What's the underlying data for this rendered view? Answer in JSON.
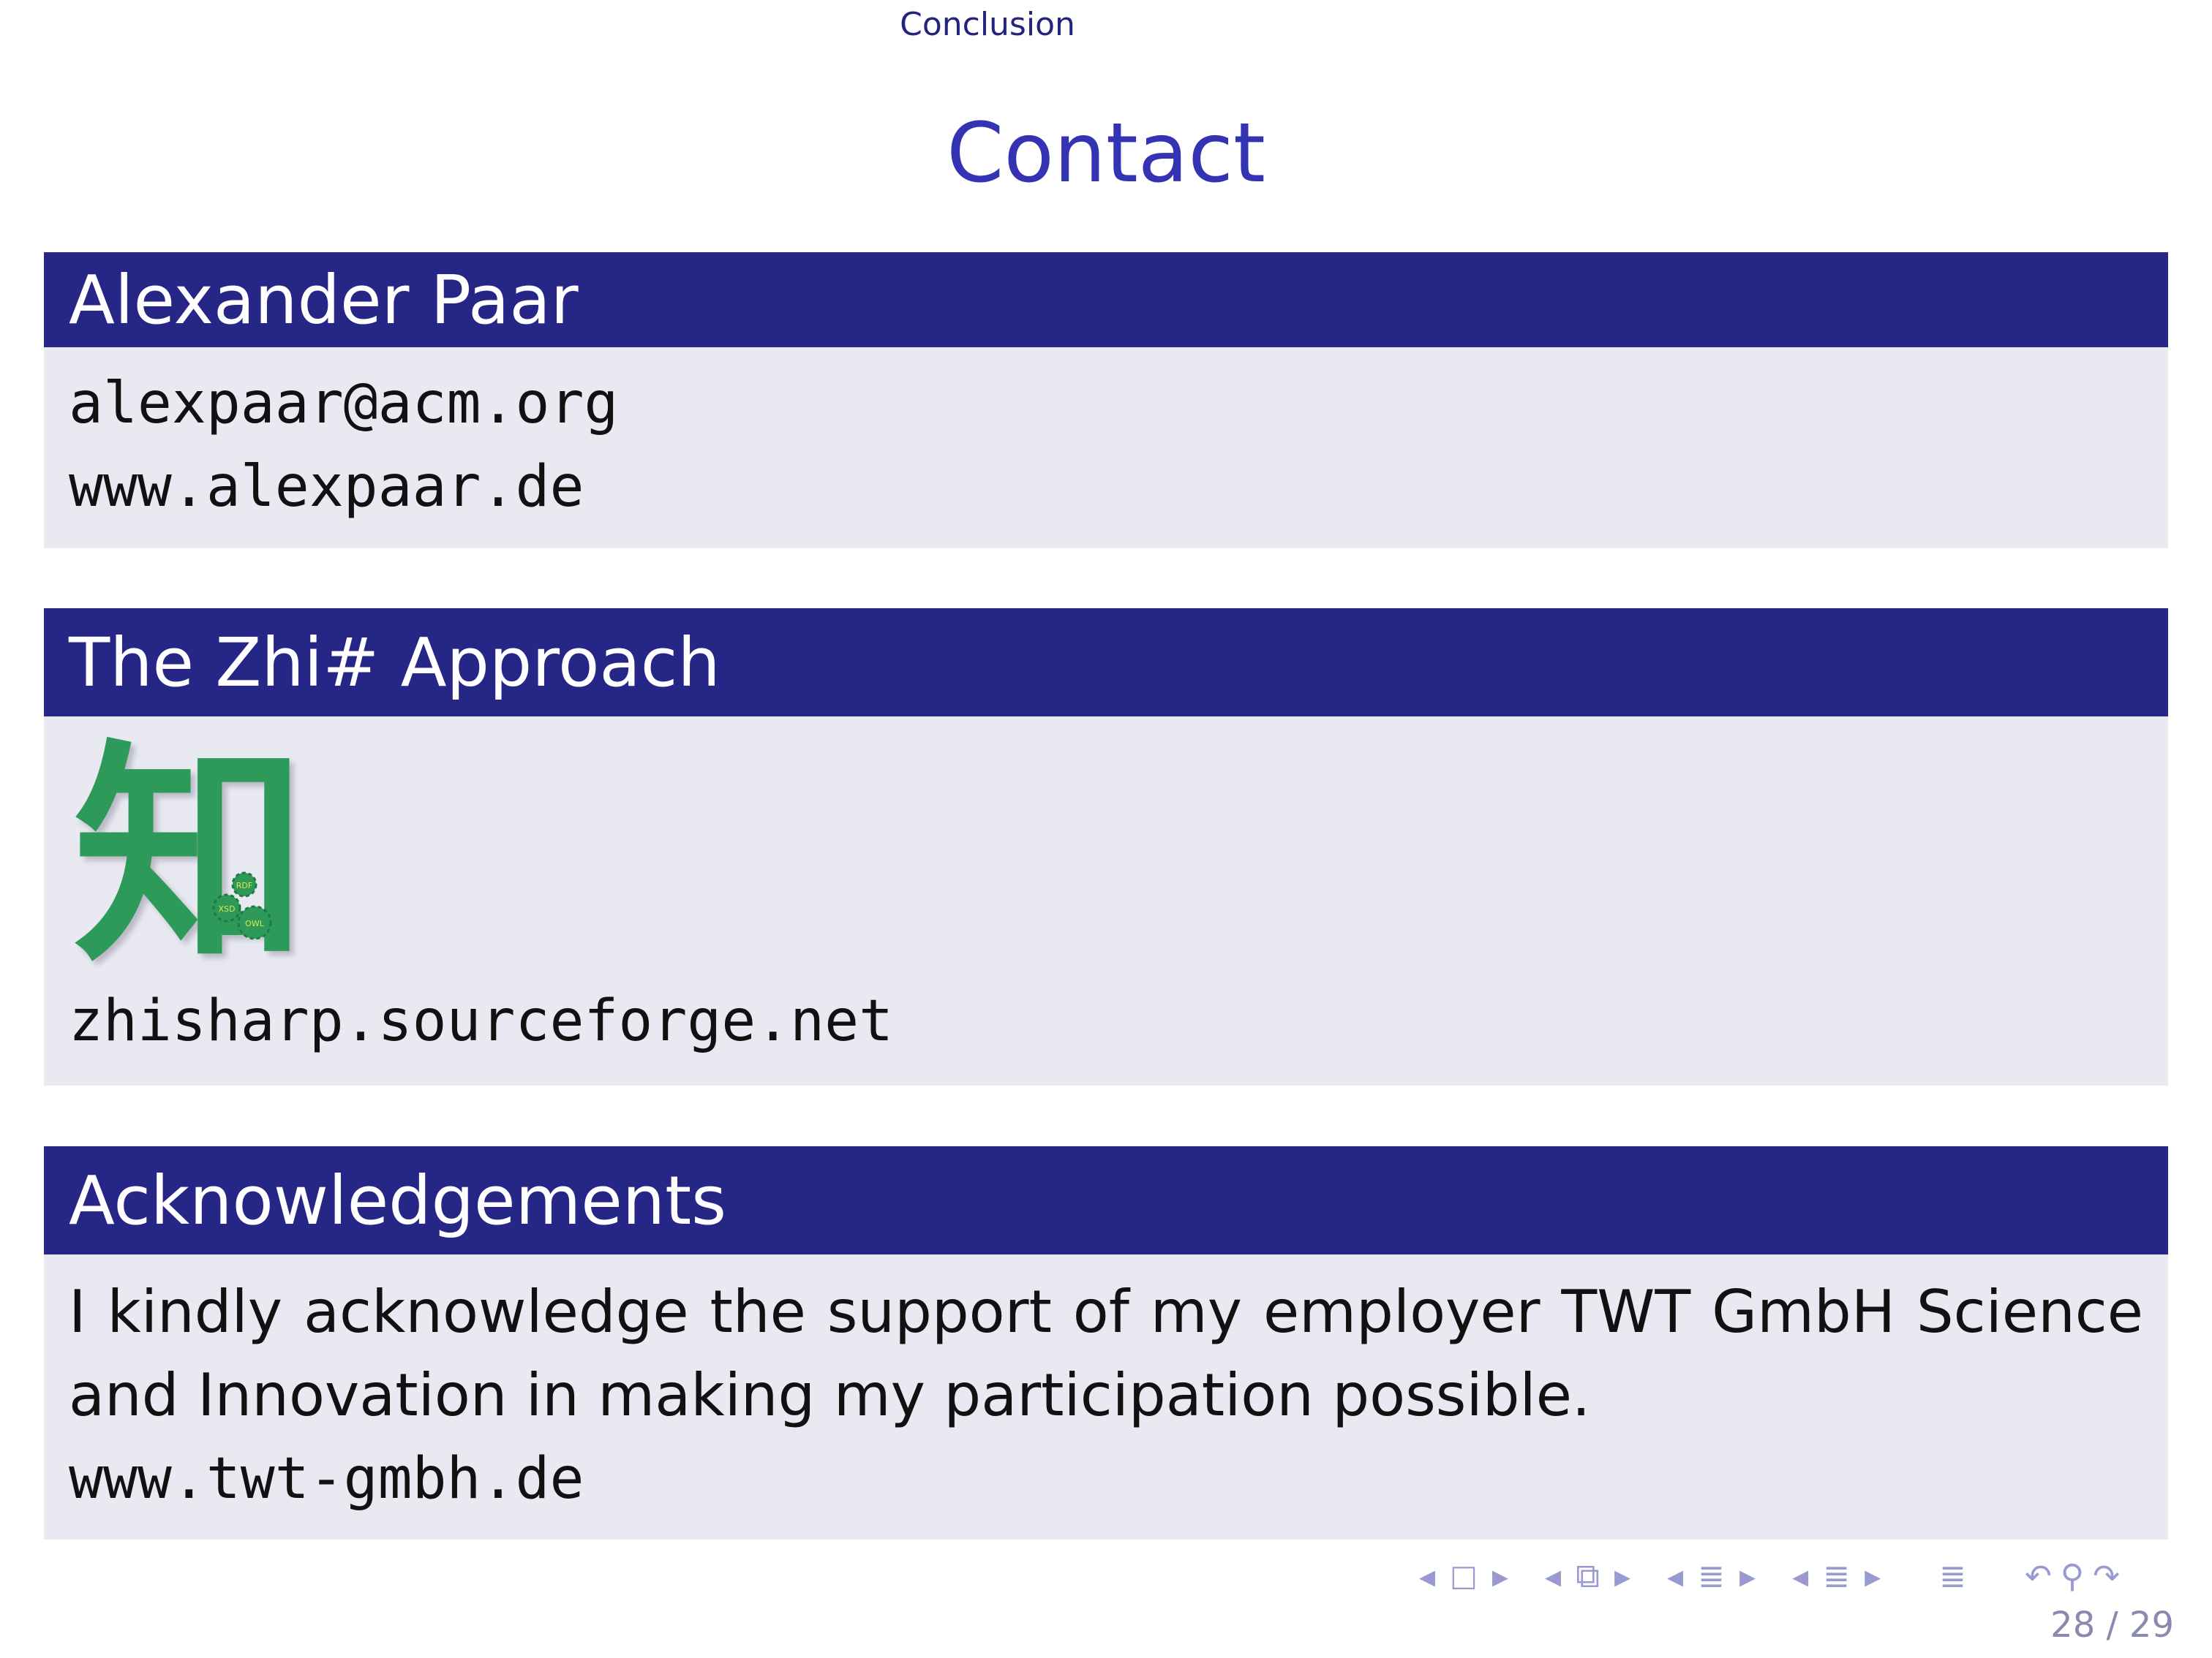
{
  "header": {
    "section": "Conclusion"
  },
  "frame": {
    "title": "Contact"
  },
  "blocks": [
    {
      "title": "Alexander Paar",
      "lines": [
        "alexpaar@acm.org",
        "www.alexpaar.de"
      ]
    },
    {
      "title": "The Zhi# Approach",
      "logo": "zhi-character-logo",
      "logo_character": "知",
      "logo_labels": [
        "RDF",
        "XSD",
        "OWL"
      ],
      "url": "zhisharp.sourceforge.net"
    },
    {
      "title": "Acknowledgements",
      "text": "I kindly acknowledge the support of my employer TWT GmbH Science and Innovation in making my participation possible.",
      "url": "www.twt-gmbh.de"
    }
  ],
  "nav": {
    "icons": [
      "nav-left-icon",
      "frame-icon",
      "nav-right-icon",
      "nav-left-icon",
      "subsection-icon",
      "nav-right-icon",
      "nav-left-icon",
      "section-icon",
      "nav-right-icon",
      "nav-left-icon",
      "document-icon",
      "nav-right-icon",
      "toc-icon",
      "back-icon",
      "search-icon",
      "forward-icon"
    ]
  },
  "page": {
    "current": "28",
    "total": "29",
    "label": "28 / 29"
  },
  "colors": {
    "block_head": "#262686",
    "block_body": "#e9e9f2",
    "title": "#3333b3",
    "logo_green": "#2e9a5a"
  }
}
